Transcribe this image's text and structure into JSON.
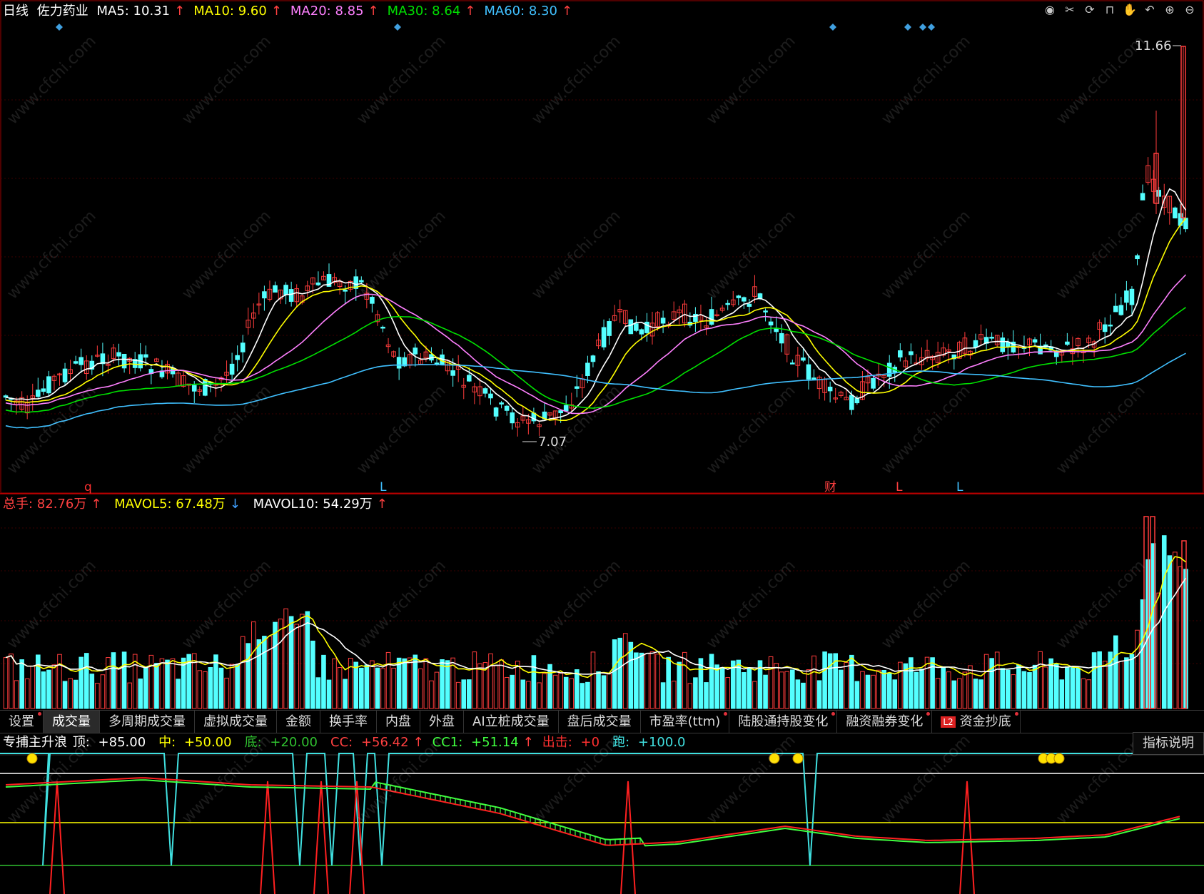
{
  "header": {
    "period": "日线",
    "stock_name": "佐力药业",
    "ma": [
      {
        "label": "MA5: 10.31",
        "arrow": "↑",
        "color": "#ffffff"
      },
      {
        "label": "MA10: 9.60",
        "arrow": "↑",
        "color": "#ffff00"
      },
      {
        "label": "MA20: 8.85",
        "arrow": "↑",
        "color": "#ff80ff"
      },
      {
        "label": "MA30: 8.64",
        "arrow": "↑",
        "color": "#00e000"
      },
      {
        "label": "MA60: 8.30",
        "arrow": "↑",
        "color": "#40c0ff"
      }
    ]
  },
  "price_chart": {
    "high_label": "11.66",
    "low_label": "7.07",
    "markers": [
      {
        "text": "q",
        "color": "#ff3030"
      },
      {
        "text": "L",
        "color": "#40c0ff"
      },
      {
        "text": "财",
        "color": "#ff4040"
      },
      {
        "text": "L",
        "color": "#ff4040"
      },
      {
        "text": "L",
        "color": "#40c0ff"
      }
    ]
  },
  "volume_header": {
    "total": {
      "label": "总手: 82.76万",
      "arrow": "↑",
      "color": "#ff4040"
    },
    "mavol5": {
      "label": "MAVOL5: 67.48万",
      "arrow": "↓",
      "color": "#ffff00"
    },
    "mavol10": {
      "label": "MAVOL10: 54.29万",
      "arrow": "↑",
      "color": "#ffffff"
    }
  },
  "tabs": [
    {
      "label": "设置",
      "active": false,
      "dot": true
    },
    {
      "label": "成交量",
      "active": true,
      "dot": false
    },
    {
      "label": "多周期成交量",
      "active": false,
      "dot": false
    },
    {
      "label": "虚拟成交量",
      "active": false,
      "dot": false
    },
    {
      "label": "金额",
      "active": false,
      "dot": false
    },
    {
      "label": "换手率",
      "active": false,
      "dot": false
    },
    {
      "label": "内盘",
      "active": false,
      "dot": false
    },
    {
      "label": "外盘",
      "active": false,
      "dot": false
    },
    {
      "label": "AI立桩成交量",
      "active": false,
      "dot": false
    },
    {
      "label": "盘后成交量",
      "active": false,
      "dot": false
    },
    {
      "label": "市盈率(ttm)",
      "active": false,
      "dot": true
    },
    {
      "label": "陆股通持股变化",
      "active": false,
      "dot": true
    },
    {
      "label": "融资融券变化",
      "active": false,
      "dot": true
    },
    {
      "label": "资金抄底",
      "active": false,
      "dot": true,
      "badge": "L2"
    }
  ],
  "indicator_header": {
    "name": "专捕主升浪",
    "items": [
      {
        "label": "顶: ",
        "value": "+85.00",
        "arrow": "",
        "color": "#ffffff"
      },
      {
        "label": "中: ",
        "value": "+50.00",
        "arrow": "",
        "color": "#ffff00"
      },
      {
        "label": "底: ",
        "value": "+20.00",
        "arrow": "",
        "color": "#30c030"
      },
      {
        "label": "CC: ",
        "value": "+56.42",
        "arrow": "↑",
        "color": "#ff4040"
      },
      {
        "label": "CC1: ",
        "value": "+51.14",
        "arrow": "↑",
        "color": "#40ff40"
      },
      {
        "label": "出击: ",
        "value": "+0",
        "arrow": "",
        "color": "#ff3030"
      },
      {
        "label": "跑: ",
        "value": "+100.0",
        "arrow": "",
        "color": "#40e0e0"
      }
    ],
    "help_label": "指标说明"
  },
  "watermark": "www.cfchi.com",
  "colors": {
    "up": "#ff3c3c",
    "down": "#54ffff",
    "grid": "#3a0000",
    "border": "#b00000"
  }
}
